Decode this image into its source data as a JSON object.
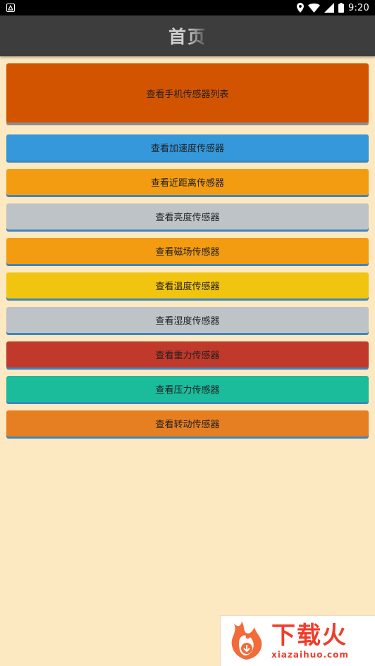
{
  "status_bar": {
    "time": "9:20",
    "icons": [
      "android-icon",
      "location-icon",
      "wifi-icon",
      "signal-icon",
      "battery-icon"
    ]
  },
  "app_bar": {
    "title": "首页",
    "background": "#3d3d3d"
  },
  "main_button": {
    "label": "查看手机传感器列表",
    "color": "#d35400"
  },
  "sensor_buttons": [
    {
      "label": "查看加速度传感器",
      "color": "#3498db"
    },
    {
      "label": "查看近距离传感器",
      "color": "#f39c12"
    },
    {
      "label": "查看亮度传感器",
      "color": "#bdc3c7"
    },
    {
      "label": "查看磁场传感器",
      "color": "#f39c12"
    },
    {
      "label": "查看温度传感器",
      "color": "#f1c40f"
    },
    {
      "label": "查看湿度传感器",
      "color": "#bdc3c7"
    },
    {
      "label": "查看重力传感器",
      "color": "#c0392b"
    },
    {
      "label": "查看压力传感器",
      "color": "#1abc9c"
    },
    {
      "label": "查看转动传感器",
      "color": "#e67e22"
    }
  ],
  "watermark": {
    "cn": "下载火",
    "en": "xiazaihuo.com",
    "color": "#ef3d2b"
  },
  "background": "#fde9c1"
}
